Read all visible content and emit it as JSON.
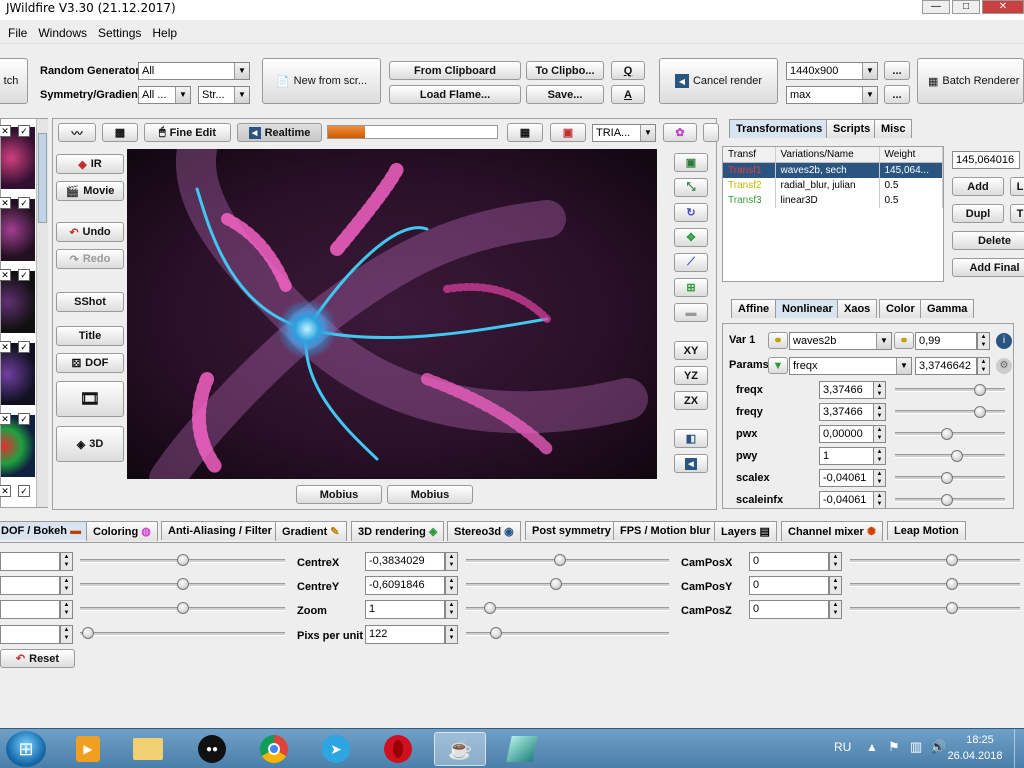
{
  "window": {
    "title": "JWildfire V3.30 (21.12.2017)",
    "min": "—",
    "max": "□",
    "close": "✕"
  },
  "menu": [
    "File",
    "Windows",
    "Settings",
    "Help"
  ],
  "toolbar": {
    "batch_left": "tch",
    "random_generator_label": "Random Generator",
    "random_generator_value": "All",
    "symmetry_label": "Symmetry/Gradient",
    "symmetry_value": "All ...",
    "gradient_value": "Str...",
    "new_from_scratch": "New from scr...",
    "from_clipboard": "From Clipboard",
    "to_clipboard": "To Clipbo...",
    "q": "Q",
    "load_flame": "Load Flame...",
    "save": "Save...",
    "a": "A",
    "cancel_render": "Cancel render",
    "resolution": "1440x900",
    "quality": "max",
    "more": "...",
    "batch_renderer": "Batch Renderer"
  },
  "left_tools": {
    "ir": "IR",
    "movie": "Movie",
    "undo": "Undo",
    "redo": "Redo",
    "sshot": "SShot",
    "title": "Title",
    "dof": "DOF",
    "three_d": "3D"
  },
  "preview_toolbar": {
    "fine_edit": "Fine Edit",
    "realtime": "Realtime",
    "tria": "TRIA...",
    "progress": 0.22
  },
  "right_tools": {
    "xy": "XY",
    "yz": "YZ",
    "zx": "ZX"
  },
  "mobius": [
    "Mobius",
    "Mobius"
  ],
  "transform_tabs": [
    "Transformations",
    "Scripts",
    "Misc"
  ],
  "transform_table": {
    "headers": [
      "Transf",
      "Variations/Name",
      "Weight"
    ],
    "rows": [
      {
        "name": "Transf1",
        "vars": "waves2b, sech",
        "weight": "145,064...",
        "color": "#e04040"
      },
      {
        "name": "Transf2",
        "vars": "radial_blur, julian",
        "weight": "0.5",
        "color": "#c8b400"
      },
      {
        "name": "Transf3",
        "vars": "linear3D",
        "weight": "0.5",
        "color": "#3aa03a"
      }
    ]
  },
  "transform_side": {
    "weight_value": "145,064016",
    "add": "Add",
    "dupl": "Dupl",
    "delete": "Delete",
    "add_final": "Add Final",
    "l": "L",
    "t": "T"
  },
  "nonlinear_tabs": [
    "Affine",
    "Nonlinear",
    "Xaos",
    "Color",
    "Gamma"
  ],
  "nonlinear": {
    "var_label": "Var 1",
    "var_name": "waves2b",
    "var_amount": "0,99",
    "params_label": "Params",
    "params_name": "freqx",
    "params_value": "3,3746642",
    "params": [
      {
        "name": "freqx",
        "value": "3,37466",
        "pos": 0.82
      },
      {
        "name": "freqy",
        "value": "3,37466",
        "pos": 0.82
      },
      {
        "name": "pwx",
        "value": "0,00000",
        "pos": 0.5
      },
      {
        "name": "pwy",
        "value": "1",
        "pos": 0.6
      },
      {
        "name": "scalex",
        "value": "-0,04061",
        "pos": 0.5
      },
      {
        "name": "scaleinfx",
        "value": "-0,04061",
        "pos": 0.5
      }
    ]
  },
  "bottom_tabs": [
    "DOF / Bokeh",
    "Coloring",
    "Anti-Aliasing / Filter",
    "Gradient",
    "3D rendering",
    "Stereo3d",
    "Post symmetry",
    "FPS / Motion blur",
    "Layers",
    "Channel mixer",
    "Leap Motion"
  ],
  "camera": {
    "centre_x_label": "CentreX",
    "centre_x": "-0,3834029",
    "centre_y_label": "CentreY",
    "centre_y": "-0,6091846",
    "zoom_label": "Zoom",
    "zoom": "1",
    "pix_label": "Pixs per unit",
    "pix": "122",
    "campos_x_label": "CamPosX",
    "campos_x": "0",
    "campos_y_label": "CamPosY",
    "campos_y": "0",
    "campos_z_label": "CamPosZ",
    "campos_z": "0",
    "reset": "Reset"
  },
  "taskbar": {
    "lang": "RU",
    "time": "18:25",
    "date": "26.04.2018"
  },
  "colors": {
    "accent": "#2a5580",
    "progress": "#e06a10",
    "selection": "#2a5580"
  }
}
